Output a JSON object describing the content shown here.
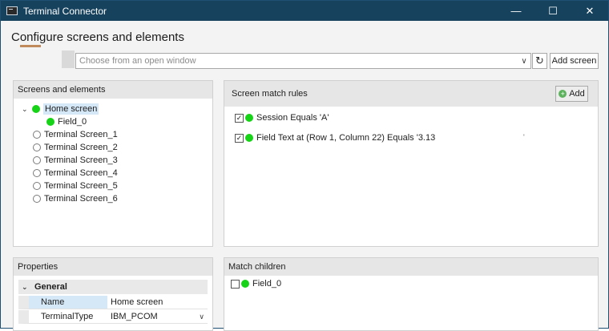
{
  "window": {
    "title": "Terminal Connector",
    "controls": {
      "minimize": "—",
      "maximize": "☐",
      "close": "✕"
    }
  },
  "header": {
    "heading": "Configure screens and elements",
    "window_picker_placeholder": "Choose from an open window",
    "refresh_icon": "refresh-icon",
    "add_screen_label": "Add screen"
  },
  "screens_panel": {
    "title": "Screens and elements",
    "root": {
      "label": "Home screen",
      "status": "matched",
      "expanded": true
    },
    "root_children": [
      {
        "label": "Field_0",
        "status": "matched"
      }
    ],
    "screens": [
      {
        "label": "Terminal Screen_1"
      },
      {
        "label": "Terminal Screen_2"
      },
      {
        "label": "Terminal Screen_3"
      },
      {
        "label": "Terminal Screen_4"
      },
      {
        "label": "Terminal Screen_5"
      },
      {
        "label": "Terminal Screen_6"
      }
    ]
  },
  "rules_panel": {
    "title": "Screen match rules",
    "add_label": "Add",
    "rules": [
      {
        "checked": true,
        "label": "Session Equals 'A'"
      },
      {
        "checked": true,
        "label": "Field Text at (Row 1, Column 22) Equals '3.13"
      }
    ],
    "stray_mark": "'"
  },
  "properties_panel": {
    "title": "Properties",
    "group": "General",
    "rows": [
      {
        "name": "Name",
        "value": "Home screen"
      },
      {
        "name": "TerminalType",
        "value": "IBM_PCOM"
      }
    ]
  },
  "children_panel": {
    "title": "Match children",
    "items": [
      {
        "checked": false,
        "label": "Field_0"
      }
    ]
  },
  "colors": {
    "titlebar": "#16425e",
    "matched_dot": "#17d317",
    "selection": "#d5e8f7",
    "panel_header": "#e6e6e6"
  }
}
